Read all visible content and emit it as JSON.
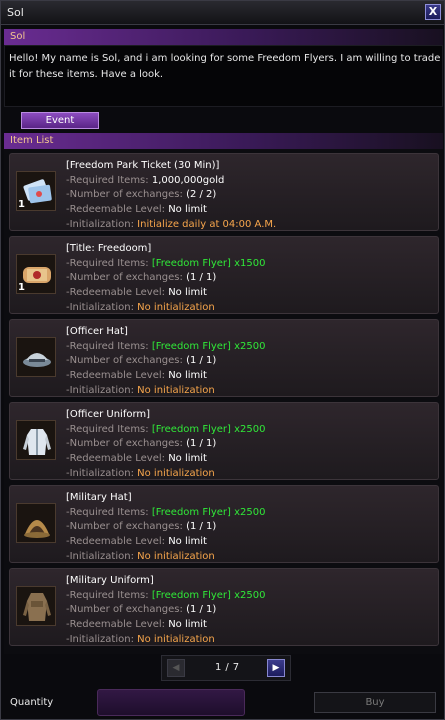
{
  "window": {
    "title": "Sol",
    "close_glyph": "X"
  },
  "npc": {
    "name": "Sol",
    "dialog": "Hello! My name is Sol, and i am looking for some Freedom Flyers. I am willing to trade it for these items. Have a look."
  },
  "tabs": {
    "event_label": "Event"
  },
  "section": {
    "title": "Item List"
  },
  "labels": {
    "required": "-Required Items:",
    "exchanges": "-Number of exchanges:",
    "level": "-Redeemable Level:",
    "init": "-Initialization:"
  },
  "items": [
    {
      "name": "[Freedom Park Ticket (30 Min)]",
      "icon": "ticket-icon",
      "stack": "1",
      "required": "1,000,000gold",
      "required_color": "white",
      "exchanges": "(2 / 2)",
      "level": "No limit",
      "init": "Initialize daily at 04:00 A.M.",
      "init_color": "orange"
    },
    {
      "name": "[Title: Freedoom]",
      "icon": "title-scroll-icon",
      "stack": "1",
      "required": "[Freedom Flyer] x1500",
      "required_color": "green",
      "exchanges": "(1 / 1)",
      "level": "No limit",
      "init": "No initialization",
      "init_color": "orange"
    },
    {
      "name": "[Officer Hat]",
      "icon": "officer-hat-icon",
      "stack": "",
      "required": "[Freedom Flyer] x2500",
      "required_color": "green",
      "exchanges": "(1 / 1)",
      "level": "No limit",
      "init": "No initialization",
      "init_color": "orange"
    },
    {
      "name": "[Officer Uniform]",
      "icon": "officer-uniform-icon",
      "stack": "",
      "required": "[Freedom Flyer] x2500",
      "required_color": "green",
      "exchanges": "(1 / 1)",
      "level": "No limit",
      "init": "No initialization",
      "init_color": "orange"
    },
    {
      "name": "[Military Hat]",
      "icon": "military-hat-icon",
      "stack": "",
      "required": "[Freedom Flyer] x2500",
      "required_color": "green",
      "exchanges": "(1 / 1)",
      "level": "No limit",
      "init": "No initialization",
      "init_color": "orange"
    },
    {
      "name": "[Military Uniform]",
      "icon": "military-uniform-icon",
      "stack": "",
      "required": "[Freedom Flyer] x2500",
      "required_color": "green",
      "exchanges": "(1 / 1)",
      "level": "No limit",
      "init": "No initialization",
      "init_color": "orange"
    }
  ],
  "pagination": {
    "current": "1",
    "separator": "/",
    "total": "7"
  },
  "footer": {
    "quantity_label": "Quantity",
    "quantity_value": "",
    "buy_label": "Buy"
  },
  "colors": {
    "accent_purple": "#6a2c92",
    "green": "#30e838",
    "orange": "#f7a64c",
    "label_gray": "#9a9090",
    "title_gold": "#f3c690"
  }
}
